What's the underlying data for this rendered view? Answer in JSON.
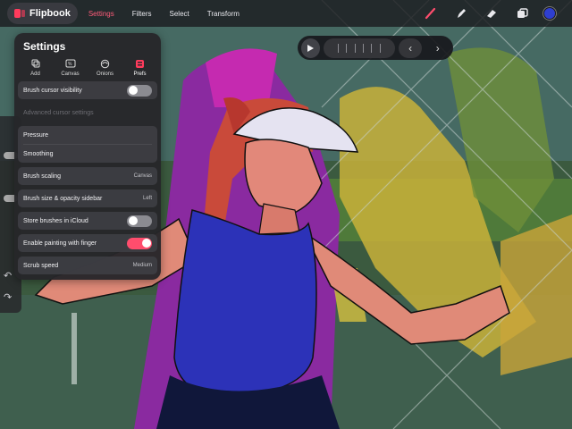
{
  "app": {
    "name": "Flipbook"
  },
  "menu": [
    {
      "label": "Settings",
      "active": true
    },
    {
      "label": "Filters",
      "active": false
    },
    {
      "label": "Select",
      "active": false
    },
    {
      "label": "Transform",
      "active": false
    }
  ],
  "tools": {
    "brush_icon": "brush-icon",
    "smudge_icon": "smudge-icon",
    "eraser_icon": "eraser-icon",
    "layers_icon": "layers-icon",
    "current_color": "#2f3fcf"
  },
  "settings": {
    "title": "Settings",
    "tabs": [
      {
        "label": "Add",
        "icon": "add-frame-icon",
        "active": false
      },
      {
        "label": "Canvas",
        "icon": "canvas-icon",
        "active": false
      },
      {
        "label": "Onions",
        "icon": "onion-skin-icon",
        "active": false
      },
      {
        "label": "Prefs",
        "icon": "prefs-icon",
        "active": true
      }
    ],
    "brush_cursor_visibility": {
      "label": "Brush cursor visibility",
      "enabled": false
    },
    "advanced_cursor_settings": {
      "label": "Advanced cursor settings",
      "disabled": true
    },
    "pressure": {
      "label": "Pressure"
    },
    "smoothing": {
      "label": "Smoothing"
    },
    "brush_scaling": {
      "label": "Brush scaling",
      "value": "Canvas"
    },
    "brush_sidebar": {
      "label": "Brush size & opacity sidebar",
      "value": "Left"
    },
    "store_brushes": {
      "label": "Store brushes in iCloud",
      "enabled": false
    },
    "finger_painting": {
      "label": "Enable painting with finger",
      "enabled": true
    },
    "scrub_speed": {
      "label": "Scrub speed",
      "value": "Medium"
    }
  },
  "colors": {
    "accent": "#ff4d6d"
  }
}
